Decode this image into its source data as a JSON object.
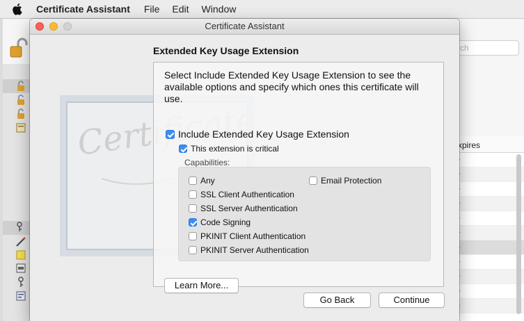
{
  "menubar": {
    "app_name": "Certificate Assistant",
    "items": [
      "File",
      "Edit",
      "Window"
    ]
  },
  "background_window": {
    "search_placeholder": "rch",
    "list_header": "xpires"
  },
  "dialog": {
    "title": "Certificate Assistant",
    "section_title": "Extended Key Usage Extension",
    "description": "Select Include Extended Key Usage Extension to see the available options and specify which ones this certificate will use.",
    "include_checkbox": {
      "label": "Include Extended Key Usage Extension",
      "checked": true
    },
    "critical_checkbox": {
      "label": "This extension is critical",
      "checked": true
    },
    "capabilities_label": "Capabilities:",
    "capabilities": [
      {
        "label": "Any",
        "checked": false
      },
      {
        "label": "SSL Client Authentication",
        "checked": false
      },
      {
        "label": "SSL Server Authentication",
        "checked": false
      },
      {
        "label": "Code Signing",
        "checked": true
      },
      {
        "label": "PKINIT Client Authentication",
        "checked": false
      },
      {
        "label": "PKINIT Server Authentication",
        "checked": false
      },
      {
        "label": "Email Protection",
        "checked": false
      }
    ],
    "watermark_text": "Certificate",
    "learn_more_label": "Learn More...",
    "go_back_label": "Go Back",
    "continue_label": "Continue"
  },
  "colors": {
    "accent": "#3b8ef5",
    "close": "#fc5f57",
    "minimize": "#fdbc2e"
  },
  "icons": [
    "apple-icon",
    "lock-icon",
    "keychain-icon",
    "key-icon",
    "certificate-icon"
  ]
}
